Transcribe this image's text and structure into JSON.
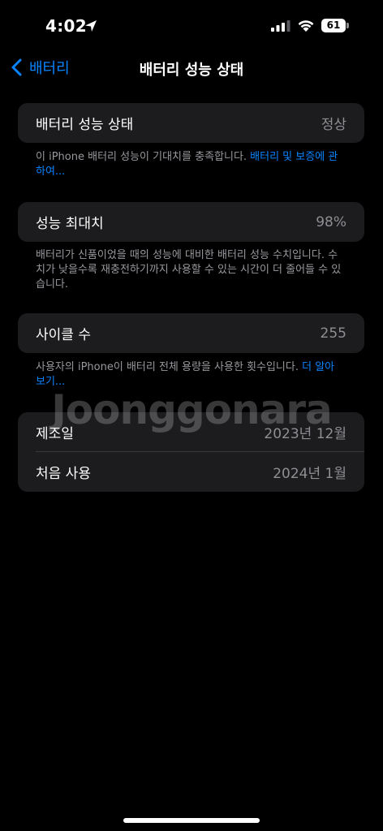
{
  "status_bar": {
    "time": "4:02",
    "battery": "61"
  },
  "nav": {
    "back_label": "배터리",
    "title": "배터리 성능 상태"
  },
  "battery_health": {
    "label": "배터리 성능 상태",
    "value": "정상",
    "footnote_text": "이 iPhone 배터리 성능이 기대치를 충족합니다. ",
    "footnote_link": "배터리 및 보증에 관하여..."
  },
  "max_capacity": {
    "label": "성능 최대치",
    "value": "98%",
    "footnote": "배터리가 신품이었을 때의 성능에 대비한 배터리 성능 수치입니다. 수치가 낮을수록 재충전하기까지 사용할 수 있는 시간이 더 줄어들 수 있습니다."
  },
  "cycle_count": {
    "label": "사이클 수",
    "value": "255",
    "footnote_text": "사용자의 iPhone이 배터리 전체 용량을 사용한 횟수입니다. ",
    "footnote_link": "더 알아보기..."
  },
  "dates": [
    {
      "label": "제조일",
      "value": "2023년 12월"
    },
    {
      "label": "처음 사용",
      "value": "2024년 1월"
    }
  ],
  "watermark": "Joonggonara",
  "colors": {
    "accent": "#0a84ff",
    "card": "#1c1c1e",
    "background": "#000000"
  }
}
